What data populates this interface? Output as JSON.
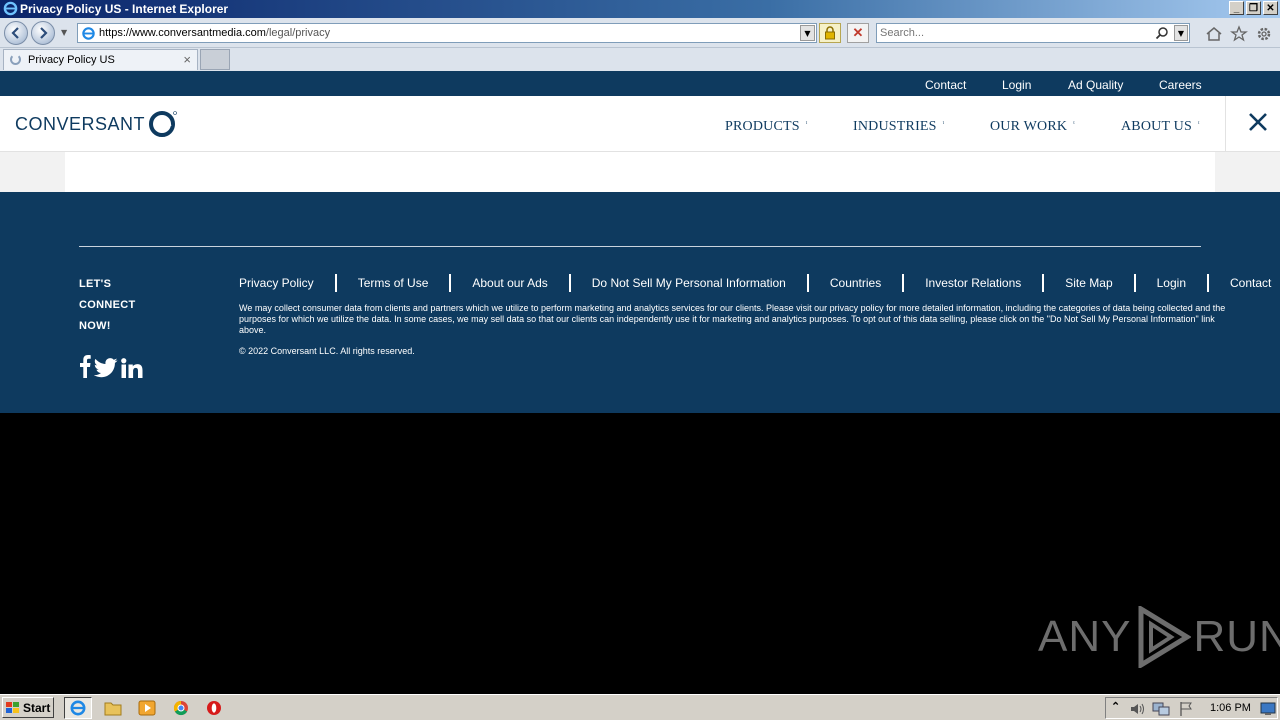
{
  "window": {
    "title": "Privacy Policy US - Internet Explorer",
    "min_label": "_",
    "restore_label": "❐",
    "close_label": "✕"
  },
  "toolbar": {
    "url_host": "https://www.conversantmedia.com",
    "url_path": "/legal/privacy",
    "search_placeholder": "Search..."
  },
  "tabs": [
    {
      "label": "Privacy Policy US",
      "close": "×"
    }
  ],
  "site": {
    "top_links": [
      "Contact",
      "Login",
      "Ad Quality",
      "Careers"
    ],
    "logo_text": "CONVERSANT",
    "nav_items": [
      "PRODUCTS",
      "INDUSTRIES",
      "OUR WORK",
      "ABOUT US"
    ],
    "caret": "ᵗ"
  },
  "footer": {
    "connect_lines": [
      "LET'S",
      "CONNECT",
      "NOW!"
    ],
    "links": [
      "Privacy Policy",
      "Terms of Use",
      "About our Ads",
      "Do Not Sell My Personal Information",
      "Countries",
      "Investor Relations",
      "Site Map",
      "Login",
      "Contact"
    ],
    "disclaimer": "We may collect consumer data from clients and partners which we utilize to perform marketing and analytics services for our clients. Please visit our privacy policy for more detailed information, including the categories of data being collected and the purposes for which we utilize the data. In some cases, we may sell data so that our clients can independently use it for marketing and analytics purposes. To opt out of this data selling, please click on the \"Do Not Sell My Personal Information\" link above.",
    "copyright": "© 2022 Conversant LLC. All rights reserved."
  },
  "watermark": {
    "left": "ANY",
    "right": "RUN"
  },
  "taskbar": {
    "start_label": "Start",
    "clock": "1:06 PM"
  },
  "colors": {
    "brand_navy": "#0e3a5f",
    "gray_strip": "#f2f2f2"
  }
}
